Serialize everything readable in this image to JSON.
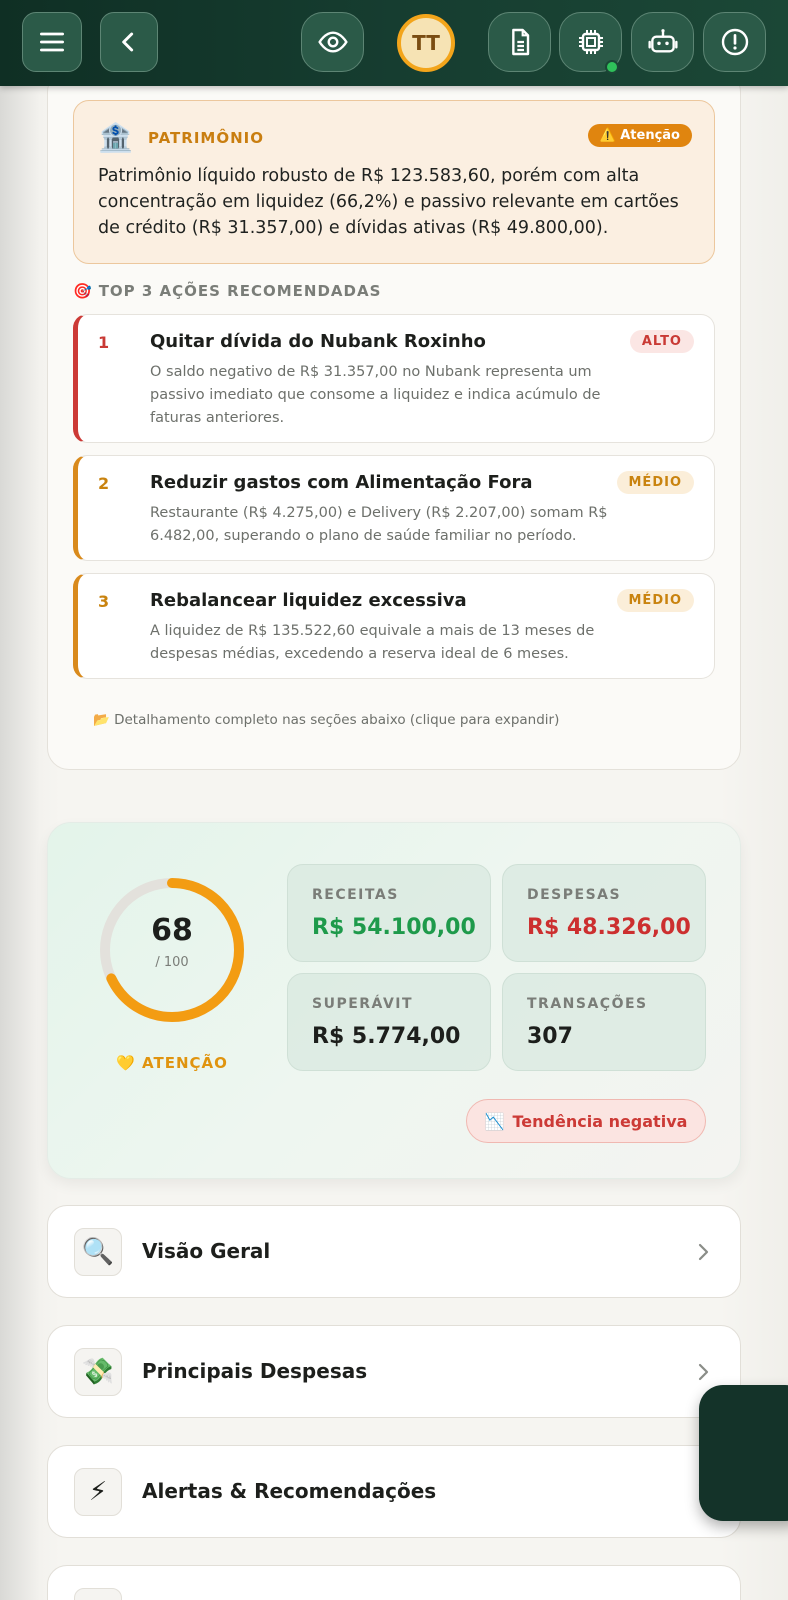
{
  "header": {
    "avatar_initials": "TT",
    "icons": [
      "menu-icon",
      "chevron-left-icon",
      "eye-icon",
      "document-icon",
      "chip-icon",
      "robot-icon",
      "alert-circle-icon"
    ]
  },
  "patrimonio": {
    "title": "PATRIMÔNIO",
    "badge": "⚠️ Atenção",
    "text": "Patrimônio líquido robusto de R$ 123.583,60, porém com alta concentração em liquidez (66,2%) e passivo relevante em cartões de crédito (R$ 31.357,00) e dívidas ativas (R$ 49.800,00)."
  },
  "top3": {
    "title": "TOP 3 AÇÕES RECOMENDADAS",
    "items": [
      {
        "num": "1",
        "title": "Quitar dívida do Nubank Roxinho",
        "badge": "ALTO",
        "desc": "O saldo negativo de R$ 31.357,00 no Nubank representa um passivo imediato que consome a liquidez e indica acúmulo de faturas anteriores."
      },
      {
        "num": "2",
        "title": "Reduzir gastos com Alimentação Fora",
        "badge": "MÉDIO",
        "desc": "Restaurante (R$ 4.275,00) e Delivery (R$ 2.207,00) somam R$ 6.482,00, superando o plano de saúde familiar no período."
      },
      {
        "num": "3",
        "title": "Rebalancear liquidez excessiva",
        "badge": "MÉDIO",
        "desc": "A liquidez de R$ 135.522,60 equivale a mais de 13 meses de despesas médias, excedendo a reserva ideal de 6 meses."
      }
    ],
    "note": "📂 Detalhamento completo nas seções abaixo (clique para expandir)"
  },
  "score": {
    "value": 68,
    "max_label": "/ 100",
    "max": 100,
    "status": "💛 ATENÇÃO",
    "accent": "#f39c12"
  },
  "stats": {
    "receitas_label": "RECEITAS",
    "receitas_value": "R$ 54.100,00",
    "despesas_label": "DESPESAS",
    "despesas_value": "R$ 48.326,00",
    "superavit_label": "SUPERÁVIT",
    "superavit_value": "R$ 5.774,00",
    "transacoes_label": "TRANSAÇÕES",
    "transacoes_value": "307"
  },
  "trend": {
    "icon": "📉",
    "label": "Tendência negativa"
  },
  "sections": [
    {
      "icon": "🔍",
      "label": "Visão Geral"
    },
    {
      "icon": "💸",
      "label": "Principais Despesas"
    },
    {
      "icon": "⚡",
      "label": "Alertas & Recomendações"
    }
  ]
}
